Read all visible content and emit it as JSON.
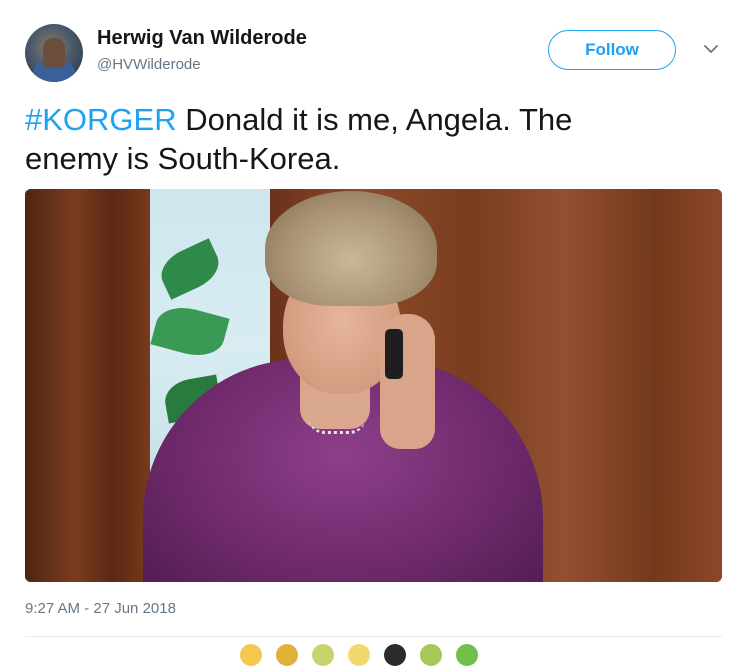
{
  "author": {
    "name": "Herwig Van Wilderode",
    "handle": "@HVWilderode"
  },
  "follow_button": {
    "label": "Follow"
  },
  "tweet": {
    "hashtag": "#KORGER",
    "text_line1": " Donald it is me, Angela. The",
    "text_line2": "enemy is South-Korea."
  },
  "timestamp": "9:27 AM - 27 Jun 2018",
  "icons": {
    "avatar": "profile-photo",
    "menu": "chevron-down-icon"
  },
  "colors": {
    "accent": "#1da1f2",
    "text": "#14171a",
    "secondary_text": "#657786",
    "divider": "#e6ecf0"
  },
  "liked_by_avatar_colors": [
    "#f2c94c",
    "#e0b23a",
    "#c9d36b",
    "#f2d96b",
    "#2b2b2b",
    "#a6c85a",
    "#6fbf4a"
  ]
}
